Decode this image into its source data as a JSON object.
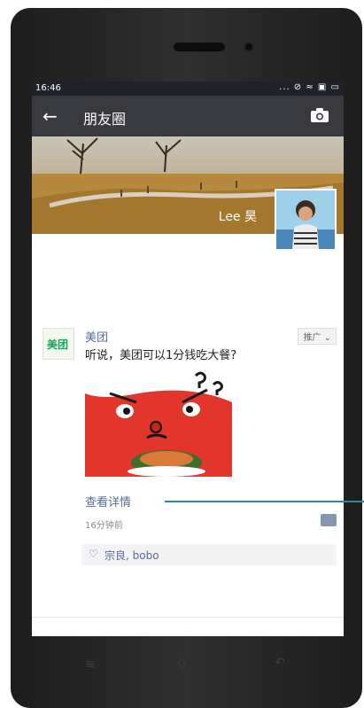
{
  "status": {
    "time": "16:46",
    "icons": "... ⊘ ≈ ▣ ▭"
  },
  "navbar": {
    "back_icon": "back-arrow-icon",
    "title": "朋友圈",
    "camera_icon": "camera-icon"
  },
  "cover": {
    "user_name": "Lee 昊"
  },
  "post": {
    "account_name": "美团",
    "logo_text": "美团",
    "ad_label": "推广 ⌄",
    "text": "听说，美团可以1分钱吃大餐?",
    "detail_link": "查看详情",
    "time_ago": "16分钟前",
    "likes_names": "宗良, bobo",
    "heart_icon": "♡"
  }
}
